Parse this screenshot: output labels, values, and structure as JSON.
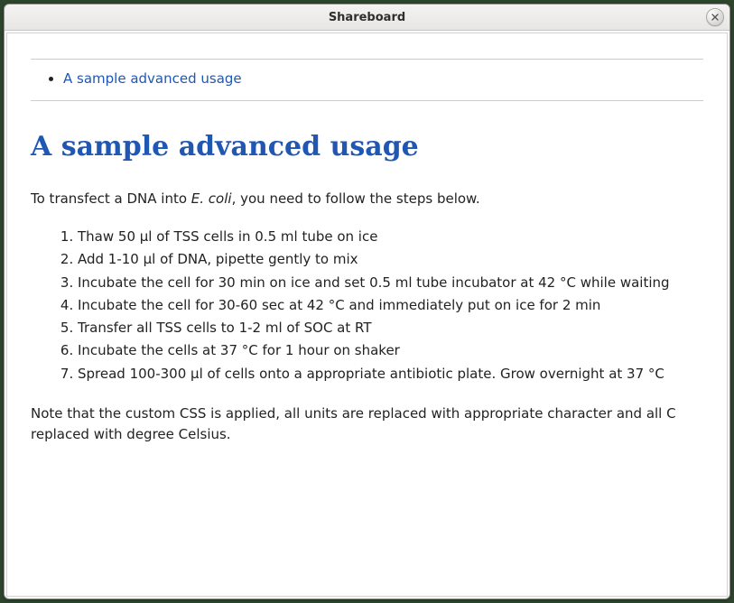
{
  "window": {
    "title": "Shareboard"
  },
  "toc": {
    "items": [
      {
        "label": "A sample advanced usage"
      }
    ]
  },
  "heading": "A sample advanced usage",
  "intro": {
    "pre": "To transfect a DNA into ",
    "ital": "E. coli",
    "post": ", you need to follow the steps below."
  },
  "steps": [
    "Thaw 50 µl of TSS cells in 0.5 ml tube on ice",
    "Add 1-10 µl of DNA, pipette gently to mix",
    "Incubate the cell for 30 min on ice and set 0.5 ml tube incubator at 42 °C while waiting",
    "Incubate the cell for 30-60 sec at 42 °C and immediately put on ice for 2 min",
    "Transfer all TSS cells to 1-2 ml of SOC at RT",
    "Incubate the cells at 37 °C for 1 hour on shaker",
    "Spread 100-300 µl of cells onto a appropriate antibiotic plate. Grow overnight at 37 °C"
  ],
  "note": "Note that the custom CSS is applied, all units are replaced with appropriate character and all C replaced with degree Celsius."
}
